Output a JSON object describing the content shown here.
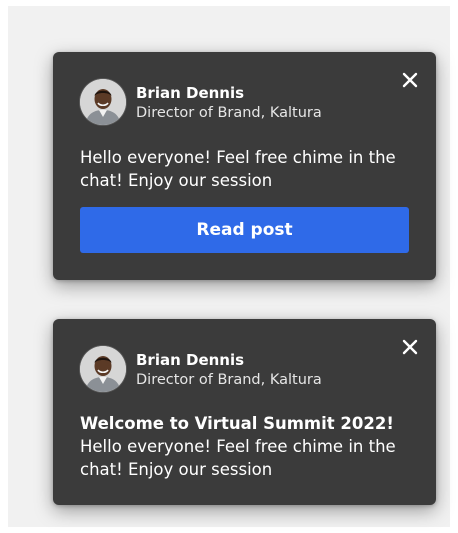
{
  "notifications": [
    {
      "author_name": "Brian Dennis",
      "author_role": "Director of Brand, Kaltura",
      "message": "Hello everyone! Feel free chime in the chat! Enjoy our session",
      "button_label": "Read post",
      "close_icon": "close-icon",
      "avatar": "avatar-photo"
    },
    {
      "author_name": "Brian Dennis",
      "author_role": "Director of Brand, Kaltura",
      "title": "Welcome to Virtual Summit 2022!",
      "message": "Hello everyone! Feel free chime in the chat! Enjoy our session",
      "close_icon": "close-icon",
      "avatar": "avatar-photo"
    }
  ],
  "colors": {
    "card_background": "#3b3b3b",
    "button_accent": "#2f6ae8",
    "page_background": "#f1f1f1"
  }
}
